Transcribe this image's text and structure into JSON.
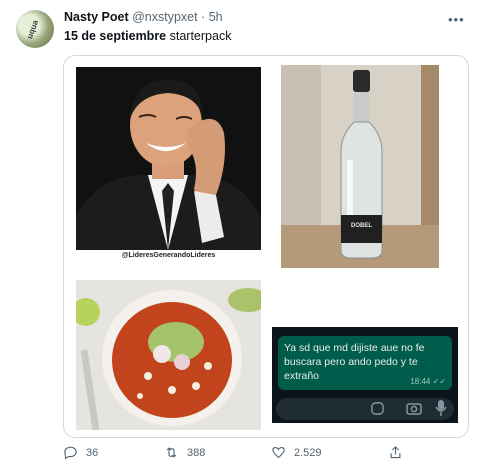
{
  "tweet": {
    "author_name": "Nasty Poet",
    "handle": "@nxstypxet",
    "separator": "·",
    "time": "5h",
    "more_icon": "more-horizontal-icon",
    "text_bold": "15 de septiembre",
    "text_rest": " starterpack",
    "avatar_text": "uqua"
  },
  "media": {
    "meme_watermark": "@LideresGenerandoLideres",
    "bottle_label": "DOBEL",
    "chat": {
      "message": "Ya sd que md dijiste aue no fe buscara pero ando pedo y te extraño",
      "time": "18:44",
      "bubble_color": "#005c4b",
      "background_color": "#0b141a"
    }
  },
  "actions": {
    "reply_count": "36",
    "retweet_count": "388",
    "like_count": "2.529"
  }
}
